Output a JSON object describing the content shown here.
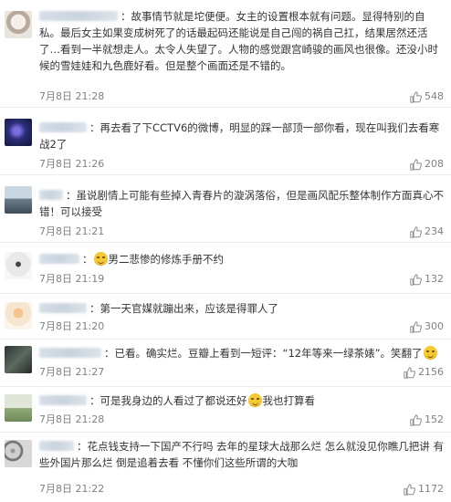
{
  "comments": [
    {
      "user": "",
      "colon": "：",
      "text": "故事情节就是坨便便。女主的设置根本就有问题。显得特别的自私。最后女主如果变成树死了的话最起码还能说是自己闯的祸自己扛，结果居然还活了…看到一半就想走人。太令人失望了。人物的感觉跟宫崎骏的画风也很像。还没小时候的雪娃娃和九色鹿好看。但是整个画面还是不错的。",
      "date": "7月8日 21:28",
      "likes": "548"
    },
    {
      "user": "",
      "colon": "：",
      "text": "再去看了下CCTV6的微博，明显的踩一部顶一部你看，现在叫我们去看寒战2了",
      "date": "7月8日 21:26",
      "likes": "208"
    },
    {
      "user": "",
      "colon": "：",
      "text": "虽说剧情上可能有些掉入青春片的漩涡落俗，但是画风配乐整体制作方面真心不错！可以接受",
      "date": "7月8日 21:21",
      "likes": "234"
    },
    {
      "user": "",
      "colon": "：",
      "text_before": "",
      "text_after": "男二悲惨的修炼手册不约",
      "date": "7月8日 21:19",
      "likes": "132"
    },
    {
      "user": "",
      "colon": "：",
      "text": "第一天官媒就蹦出来，应该是得罪人了",
      "date": "7月8日 21:20",
      "likes": "300"
    },
    {
      "user": "",
      "colon": "：",
      "text_before": "已看。确实烂。豆瓣上看到一短评：“12年等来一绿茶婊”。笑翻了",
      "text_after": "",
      "date": "7月8日 21:27",
      "likes": "2156"
    },
    {
      "user": "",
      "colon": "：",
      "text_before": "可是我身边的人看过了都说还好",
      "text_after": "我也打算看",
      "date": "7月8日 21:28",
      "likes": "152"
    },
    {
      "user": "",
      "colon": "：",
      "text": "花点钱支持一下国产不行吗 去年的星球大战那么烂 怎么就没见你瞧几把讲 有些外国片那么烂 倒是追着去看 不懂你们这些所谓的大咖",
      "date": "7月8日 21:22",
      "likes": "1172"
    }
  ],
  "icons": {
    "like": "thumbs-up-icon",
    "emoji": "laughing-emoji-icon"
  },
  "colors": {
    "meta_text": "#808080",
    "divider": "#ececec",
    "emoji": "#f6c832"
  }
}
